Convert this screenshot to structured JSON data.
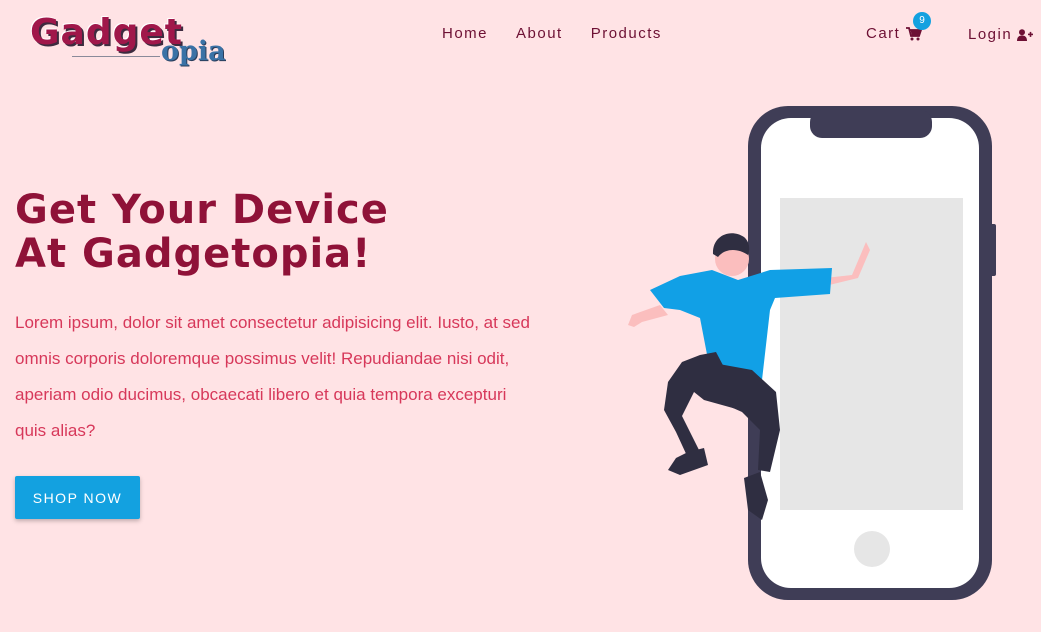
{
  "brand": {
    "name_main": "Gadget",
    "name_sub": "opia"
  },
  "nav": {
    "items": [
      {
        "label": "Home"
      },
      {
        "label": "About"
      },
      {
        "label": "Products"
      }
    ]
  },
  "header": {
    "cart_label": "Cart",
    "cart_count": "9",
    "login_label": "Login"
  },
  "hero": {
    "title_line1": "Get Your Device",
    "title_line2": "At Gadgetopia!",
    "body": "Lorem ipsum, dolor sit amet consectetur adipisicing elit. Iusto, at sed omnis corporis doloremque possimus velit! Repudiandae nisi odit, aperiam odio ducimus, obcaecati libero et quia tempora excepturi quis alias?",
    "cta_label": "SHOP NOW"
  },
  "icons": {
    "cart": "shopping-cart-icon",
    "login": "user-plus-icon"
  },
  "colors": {
    "background": "#ffe3e5",
    "accent": "#13a1e0",
    "title": "#8f1238",
    "body_text": "#d7385a",
    "nav_text": "#6d1034"
  }
}
